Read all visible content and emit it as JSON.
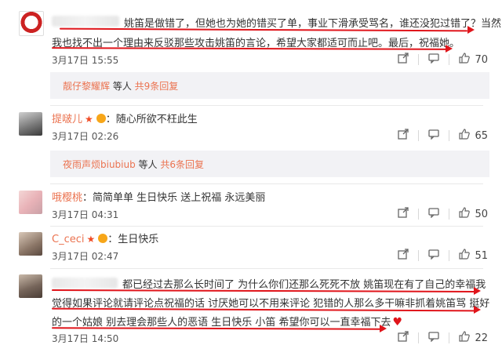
{
  "comments": [
    {
      "name": "",
      "text_line1": "姚笛是做错了，但她也为她的错买了单，事业下滑承受骂名，谁还没犯过错了？当然",
      "text_line2": "我也找不出一个理由来反驳那些攻击姚笛的言论，希望大家都适可而止吧。最后，祝福她。",
      "time": "3月17日 15:55",
      "likes": "70"
    },
    {
      "name": "提啵儿",
      "text": "随心所欲不枉此生",
      "time": "3月17日 02:26",
      "likes": "65"
    },
    {
      "name": "哦樱桃",
      "text": "简简单单 生日快乐 送上祝福 永远美丽",
      "time": "3月17日 04:31",
      "likes": "50"
    },
    {
      "name": "C_ceci",
      "text": "生日快乐",
      "time": "3月17日 02:47",
      "likes": "51"
    },
    {
      "name": "",
      "text_line1": "都已经过去那么长时间了 为什么你们还那么死死不放 姚笛现在有了自己的幸福我",
      "text_line2": "觉得如果评论就请评论点祝福的话 讨厌她可以不用来评论 犯错的人那么多干嘛非抓着姚笛骂 挺好",
      "text_line3": "的一个姑娘 别去理会那些人的恶语 生日快乐 小笛 希望你可以一直幸福下去",
      "time": "3月17日 14:50",
      "likes": "22"
    }
  ],
  "replies": [
    {
      "user": "靓仔黎耀辉",
      "middle": " 等人 ",
      "count": "共9条回复"
    },
    {
      "user": "夜雨声烦biubiub",
      "middle": " 等人 ",
      "count": "共6条回复"
    }
  ],
  "colors": {
    "accent": "#eb7350",
    "annotation": "#e0151b"
  },
  "icons": {
    "share": "share-icon",
    "comment": "comment-icon",
    "like": "thumb-up-icon"
  }
}
